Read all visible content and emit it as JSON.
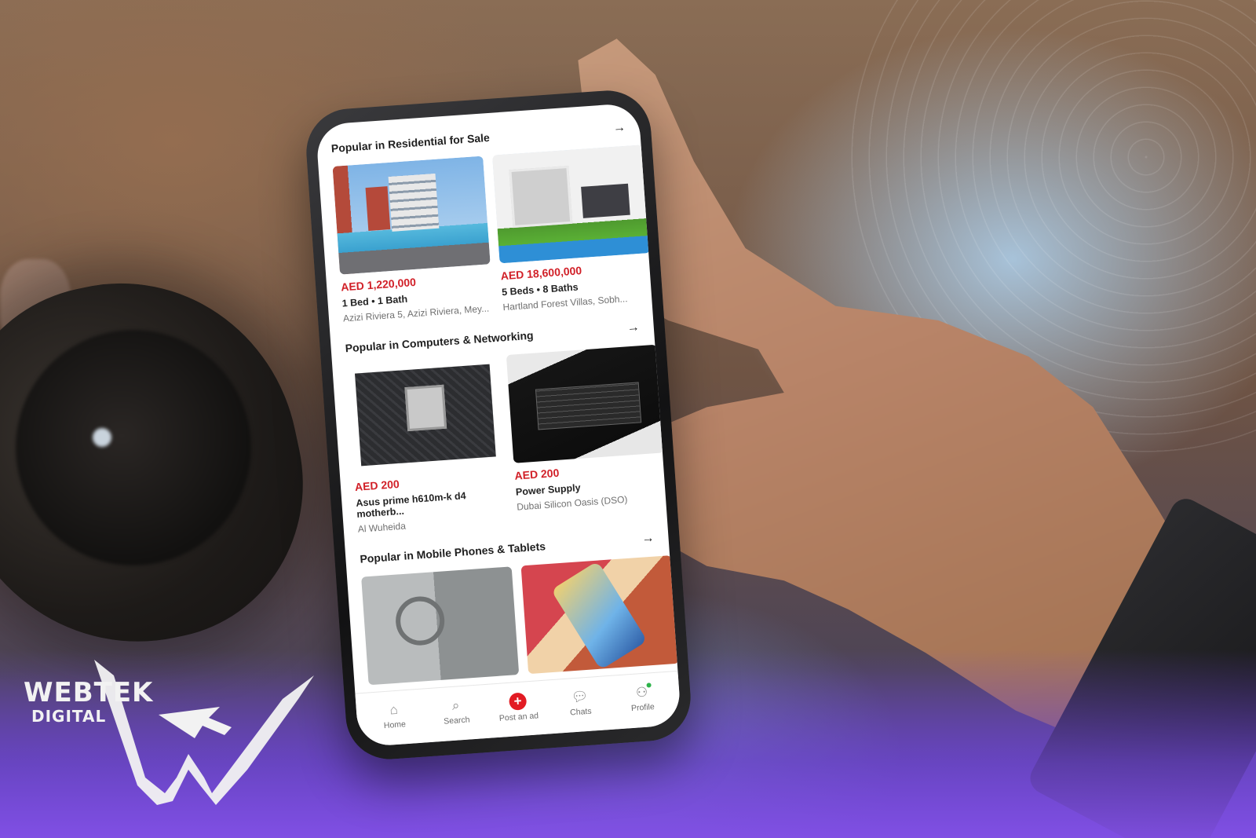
{
  "logo": {
    "line1": "WEBTEK",
    "line2": "DIGITAL"
  },
  "app": {
    "sections": [
      {
        "title": "Popular in Residential for Sale",
        "listings": [
          {
            "price": "AED 1,220,000",
            "details": "1 Bed • 1 Bath",
            "location": "Azizi Riviera 5, Azizi Riviera, Mey..."
          },
          {
            "price": "AED 18,600,000",
            "details": "5 Beds • 8 Baths",
            "location": "Hartland Forest Villas, Sobh..."
          }
        ]
      },
      {
        "title": "Popular in Computers & Networking",
        "listings": [
          {
            "price": "AED 200",
            "details": "Asus prime h610m-k d4 motherb...",
            "location": "Al Wuheida"
          },
          {
            "price": "AED 200",
            "details": "Power Supply",
            "location": "Dubai Silicon Oasis (DSO)"
          }
        ]
      },
      {
        "title": "Popular in Mobile Phones & Tablets",
        "listings": []
      }
    ],
    "nav": {
      "home": "Home",
      "search": "Search",
      "post": "Post an ad",
      "chats": "Chats",
      "profile": "Profile"
    }
  },
  "colors": {
    "price": "#d12028",
    "post_button": "#e21b23",
    "online_dot": "#2db34a"
  },
  "icons": [
    "arrow-right-icon",
    "home-icon",
    "search-icon",
    "plus-icon",
    "chat-icon",
    "profile-icon"
  ]
}
